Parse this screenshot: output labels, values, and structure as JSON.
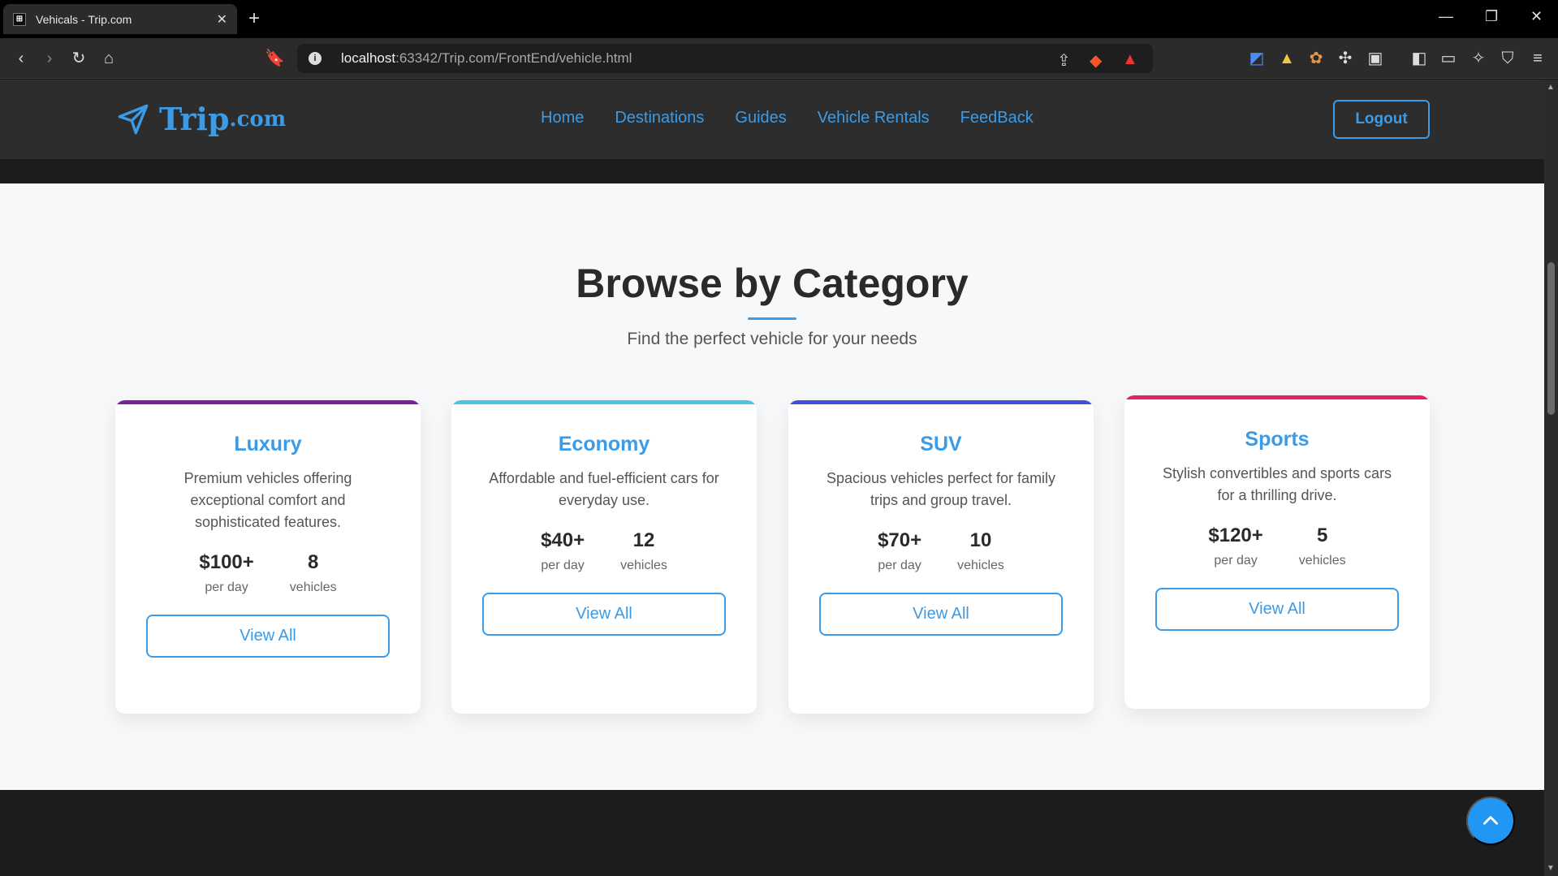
{
  "browser": {
    "tab_title": "Vehicals - Trip.com",
    "url_host": "localhost",
    "url_path": ":63342/Trip.com/FrontEnd/vehicle.html"
  },
  "nav": {
    "brand": "Trip",
    "brand_suffix": ".com",
    "links": [
      "Home",
      "Destinations",
      "Guides",
      "Vehicle Rentals",
      "FeedBack"
    ],
    "logout": "Logout"
  },
  "section": {
    "title": "Browse by Category",
    "subtitle": "Find the perfect vehicle for your needs"
  },
  "categories": [
    {
      "name": "Luxury",
      "desc": "Premium vehicles offering exceptional comfort and sophisticated features.",
      "price": "$100+",
      "price_label": "per day",
      "count": "8",
      "count_label": "vehicles",
      "button": "View All",
      "accent": "#7b1fa2"
    },
    {
      "name": "Economy",
      "desc": "Affordable and fuel-efficient cars for everyday use.",
      "price": "$40+",
      "price_label": "per day",
      "count": "12",
      "count_label": "vehicles",
      "button": "View All",
      "accent": "#4dc3e8"
    },
    {
      "name": "SUV",
      "desc": "Spacious vehicles perfect for family trips and group travel.",
      "price": "$70+",
      "price_label": "per day",
      "count": "10",
      "count_label": "vehicles",
      "button": "View All",
      "accent": "#3f51d8"
    },
    {
      "name": "Sports",
      "desc": "Stylish convertibles and sports cars for a thrilling drive.",
      "price": "$120+",
      "price_label": "per day",
      "count": "5",
      "count_label": "vehicles",
      "button": "View All",
      "accent": "#e91e63"
    }
  ],
  "colors": {
    "accent": "#3b9be6"
  }
}
